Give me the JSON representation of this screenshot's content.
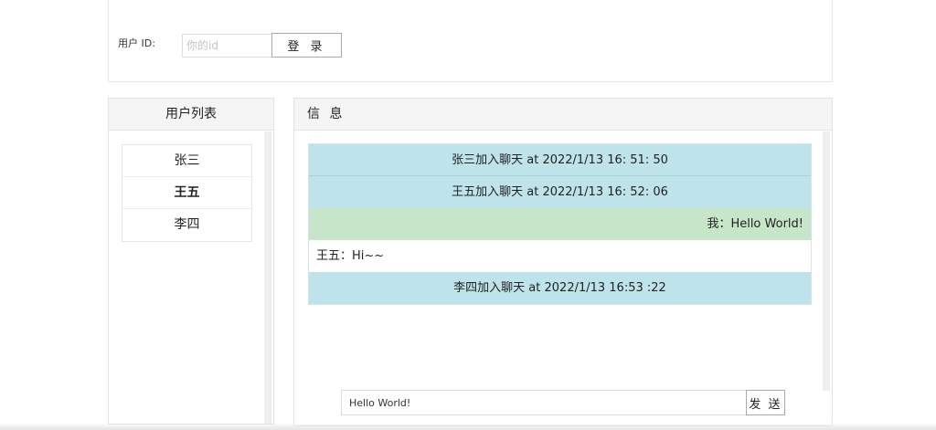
{
  "login": {
    "label": "用户 ID:",
    "input_placeholder": "你的id",
    "button_label": "登 录"
  },
  "users": {
    "header": "用户列表",
    "items": [
      {
        "name": "张三"
      },
      {
        "name": "王五"
      },
      {
        "name": "李四"
      }
    ]
  },
  "messages": {
    "header": "信 息",
    "items": [
      {
        "text": "张三加入聊天 at 2022/1/13 16: 51: 50"
      },
      {
        "text": "王五加入聊天 at 2022/1/13 16: 52: 06"
      },
      {
        "text": "我：Hello World!"
      },
      {
        "text": "王五：Hi~~"
      },
      {
        "text": "李四加入聊天 at 2022/1/13 16:53 :22"
      }
    ],
    "input_value": "Hello World!",
    "send_label": "发 送"
  },
  "colors": {
    "system_message_bg": "#bfe3ea",
    "self_message_bg": "#c6e5c9",
    "panel_header_bg": "#f5f5f5"
  }
}
